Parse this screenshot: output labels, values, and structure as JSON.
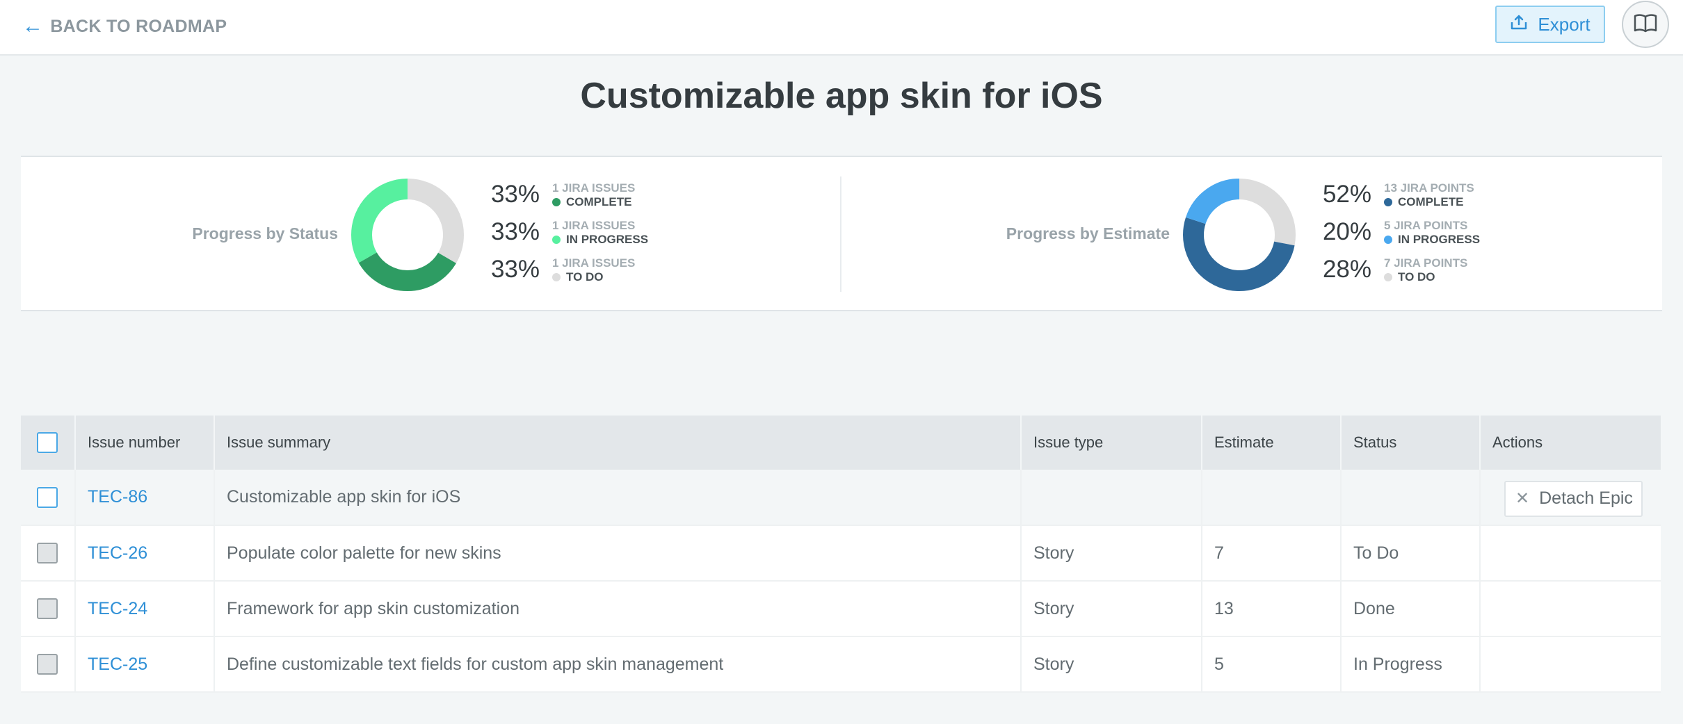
{
  "topbar": {
    "back_label": "BACK TO ROADMAP",
    "export_label": "Export",
    "export_icon": "export-upload-icon",
    "book_icon": "book-icon"
  },
  "page_title": "Customizable app skin for iOS",
  "progress": {
    "status": {
      "label": "Progress by Status",
      "segments": [
        {
          "pct": "33%",
          "count": "1 JIRA ISSUES",
          "status": "COMPLETE",
          "color": "#2e9c63",
          "fraction": 0.333
        },
        {
          "pct": "33%",
          "count": "1 JIRA ISSUES",
          "status": "IN PROGRESS",
          "color": "#57f09f",
          "fraction": 0.333
        },
        {
          "pct": "33%",
          "count": "1 JIRA ISSUES",
          "status": "TO DO",
          "color": "#dddddd",
          "fraction": 0.334
        }
      ]
    },
    "estimate": {
      "label": "Progress by Estimate",
      "segments": [
        {
          "pct": "52%",
          "count": "13 JIRA POINTS",
          "status": "COMPLETE",
          "color": "#2e6899",
          "fraction": 0.52
        },
        {
          "pct": "20%",
          "count": "5 JIRA POINTS",
          "status": "IN PROGRESS",
          "color": "#4aa8ef",
          "fraction": 0.2
        },
        {
          "pct": "28%",
          "count": "7 JIRA POINTS",
          "status": "TO DO",
          "color": "#dddddd",
          "fraction": 0.28
        }
      ]
    }
  },
  "table": {
    "headers": [
      "Issue number",
      "Issue summary",
      "Issue type",
      "Estimate",
      "Status",
      "Actions"
    ],
    "detach_label": "Detach Epic",
    "rows": [
      {
        "key": "TEC-86",
        "summary": "Customizable app skin for iOS",
        "type": "",
        "estimate": "",
        "status": ""
      },
      {
        "key": "TEC-26",
        "summary": "Populate color palette for new skins",
        "type": "Story",
        "estimate": "7",
        "status": "To Do"
      },
      {
        "key": "TEC-24",
        "summary": "Framework for app skin customization",
        "type": "Story",
        "estimate": "13",
        "status": "Done"
      },
      {
        "key": "TEC-25",
        "summary": "Define customizable text fields for custom app skin management",
        "type": "Story",
        "estimate": "5",
        "status": "In Progress"
      }
    ]
  }
}
